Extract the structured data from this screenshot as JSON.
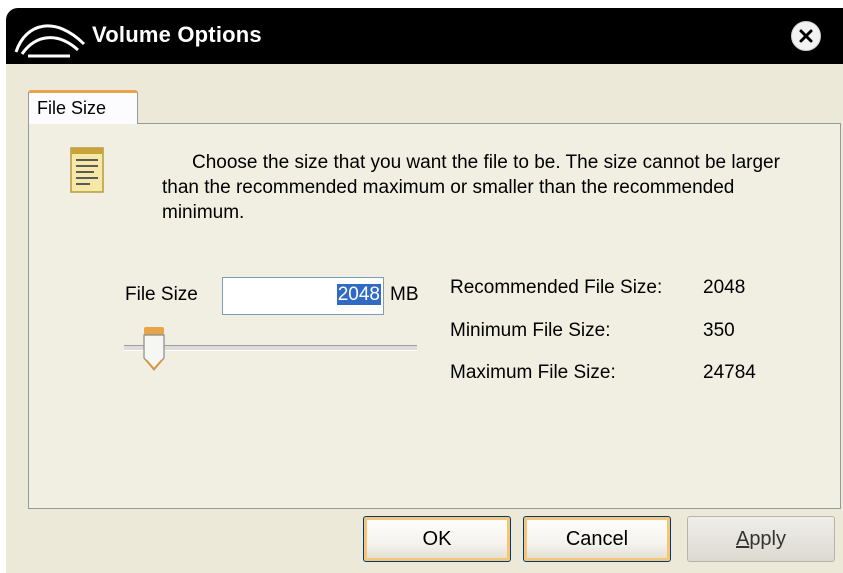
{
  "window": {
    "title": "Volume Options"
  },
  "tabs": [
    {
      "label": "File Size"
    }
  ],
  "description": "Choose the size that you want the file to be. The size cannot be larger than the recommended maximum or smaller than the recommended minimum.",
  "file_size": {
    "label": "File Size",
    "value": "2048",
    "unit": "MB",
    "slider_fraction": 0.07
  },
  "info": {
    "recommended_label": "Recommended File Size:",
    "recommended_value": "2048",
    "minimum_label": "Minimum File Size:",
    "minimum_value": "350",
    "maximum_label": "Maximum File Size:",
    "maximum_value": "24784"
  },
  "buttons": {
    "ok": "OK",
    "cancel": "Cancel",
    "apply_accel": "A",
    "apply_rest": "pply"
  },
  "icons": {
    "app": "app-logo-icon",
    "close": "close-icon",
    "document": "document-icon",
    "slider": "slider-thumb-icon"
  },
  "colors": {
    "titlebar": "#000000",
    "tab_accent": "#e9a34b",
    "focus_ring": "#f7c579",
    "selection": "#316ac5"
  }
}
